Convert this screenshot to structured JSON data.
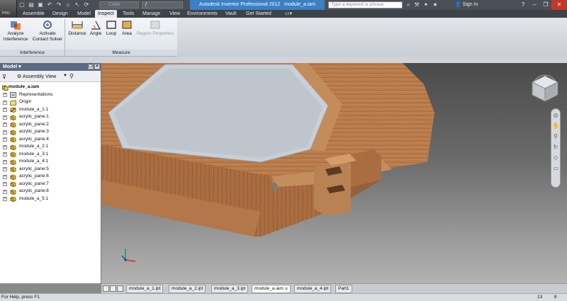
{
  "app": {
    "title": "Autodesk Inventor Professional 2012",
    "document": "module_a.iam",
    "logo_text": "PRO",
    "color_placeholder": "Color",
    "fx_value": "",
    "search_placeholder": "Type a keyword or phrase",
    "sign_in": "Sign In"
  },
  "tabs": [
    "Assemble",
    "Design",
    "Model",
    "Inspect",
    "Tools",
    "Manage",
    "View",
    "Environments",
    "Vault",
    "Get Started"
  ],
  "active_tab": "Inspect",
  "ribbon": {
    "interference_group": {
      "label": "Interference",
      "buttons": [
        {
          "label": "Analyze\nInterference",
          "line1": "Analyze",
          "line2": "Interference"
        },
        {
          "label": "Activate\nContact Solver",
          "line1": "Activate",
          "line2": "Contact Solver"
        }
      ]
    },
    "measure_group": {
      "label": "Measure",
      "buttons": [
        "Distance",
        "Angle",
        "Loop",
        "Area",
        "Region Properties"
      ]
    }
  },
  "browser": {
    "title": "Model",
    "view": "Assembly View",
    "tree": [
      {
        "label": "module_a.iam",
        "icon": "assembly-icon",
        "root": true
      },
      {
        "label": "Representations",
        "icon": "representations-icon"
      },
      {
        "label": "Origin",
        "icon": "folder-icon"
      },
      {
        "label": "module_a_1:1",
        "icon": "part-grounded-icon"
      },
      {
        "label": "acrylic_pane:1",
        "icon": "part-icon"
      },
      {
        "label": "acrylic_pane:2",
        "icon": "part-icon"
      },
      {
        "label": "acrylic_pane:3",
        "icon": "part-icon"
      },
      {
        "label": "acrylic_pane:4",
        "icon": "part-icon"
      },
      {
        "label": "module_a_2:1",
        "icon": "part-icon"
      },
      {
        "label": "module_a_3:1",
        "icon": "part-icon"
      },
      {
        "label": "module_a_4:1",
        "icon": "part-icon"
      },
      {
        "label": "acrylic_pane:5",
        "icon": "part-icon"
      },
      {
        "label": "acrylic_pane:6",
        "icon": "part-icon"
      },
      {
        "label": "acrylic_pane:7",
        "icon": "part-icon"
      },
      {
        "label": "acrylic_pane:8",
        "icon": "part-icon"
      },
      {
        "label": "module_a_5:1",
        "icon": "part-icon"
      }
    ]
  },
  "doc_tabs": [
    {
      "label": "module_a_1.ipt",
      "active": false
    },
    {
      "label": "module_a_2.ipt",
      "active": false
    },
    {
      "label": "module_a_3.ipt",
      "active": false
    },
    {
      "label": "module_a.iam",
      "active": true
    },
    {
      "label": "module_a_4.ipt",
      "active": false
    },
    {
      "label": "Part1",
      "active": false
    }
  ],
  "status": {
    "help": "For Help, press F1",
    "value1": "13",
    "value2": "8"
  },
  "colors": {
    "title_accent": "#3b7fc4",
    "wood": "#b87a4b",
    "glass": "#c9cfd6"
  }
}
